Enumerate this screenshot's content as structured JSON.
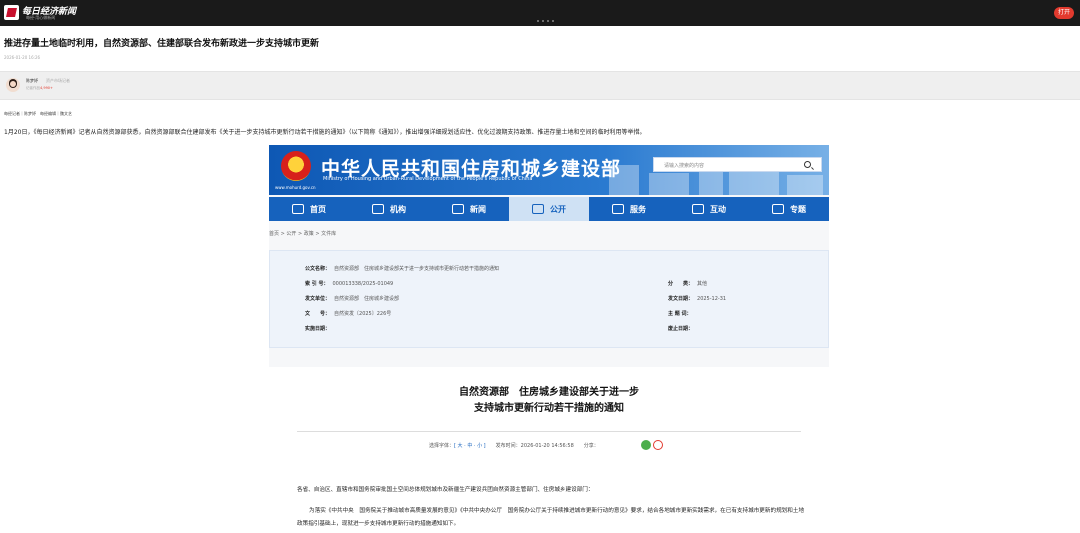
{
  "app": {
    "brand": "每日经济新闻",
    "brand_sub": "每经·用心做新闻",
    "open_label": "打开"
  },
  "article": {
    "title": "推进存量土地临时利用，自然资源部、住建部联合发布新政进一步支持城市更新",
    "datetime": "2026-01-20 16:26",
    "author_name": "陈梦妤",
    "author_role": "资产市场记者",
    "author_stat_prefix": "记者作品",
    "author_stat_count": "4,990+",
    "credits": "每经记者｜陈梦妤　每经编辑｜魏文艺",
    "lead": "1月20日，《每日经济新闻》记者从自然资源部获悉，自然资源部联合住建部发布《关于进一步支持城市更新行动若干措施的通知》（以下简称《通知》），推出增强详细规划适应性、优化过渡期支持政策、推进存量土地和空间的临时利用等举措。"
  },
  "embedded": {
    "site_cn": "中华人民共和国住房和城乡建设部",
    "site_en": "Ministry of Housing and Urban-Rural Development of the People's Republic of China",
    "site_url": "www.mohurd.gov.cn",
    "search_placeholder": "请输入搜索的内容",
    "nav": [
      "首页",
      "机构",
      "新闻",
      "公开",
      "服务",
      "互动",
      "专题"
    ],
    "breadcrumb": "首页 > 公开 > 政策 > 文件库",
    "meta": {
      "doc_name_label": "公文名称：",
      "doc_name": "自然资源部　住房城乡建设部关于进一步支持城市更新行动若干措施的通知",
      "index_label": "索 引 号：",
      "index": "000013338/2025-01049",
      "category_label": "分　　类：",
      "category": "其他",
      "issuer_label": "发文单位：",
      "issuer": "自然资源部　住房城乡建设部",
      "issue_date_label": "发文日期：",
      "issue_date": "2025-12-31",
      "number_label": "文　　号：",
      "number": "自然资发〔2025〕226号",
      "topic_label": "主 题 词：",
      "topic": "",
      "effective_label": "实施日期：",
      "effective": "",
      "expire_label": "废止日期：",
      "expire": ""
    },
    "doc_title_1": "自然资源部　住房城乡建设部关于进一步",
    "doc_title_2": "支持城市更新行动若干措施的通知",
    "font_label": "选择字体：",
    "font_sizes": "[ 大 · 中 · 小 ]",
    "publish_label": "发布时间：",
    "publish_time": "2026-01-20 14:56:58",
    "share_label": "分享：",
    "para1": "各省、自治区、直辖市和国务院审批国土空间总体规划城市及新疆生产建设兵团自然资源主管部门、住房城乡建设部门：",
    "para2": "为落实《中共中央　国务院关于推动城市高质量发展的意见》《中共中央办公厅　国务院办公厅关于持续推进城市更新行动的意见》要求，结合各地城市更新实践需求，在已有支持城市更新的规划和土地政策指引基础上，现就进一步支持城市更新行动的措施通知如下。"
  },
  "colors": {
    "topbar": "#1a1a1a",
    "accent_red": "#e23a2e",
    "gov_blue": "#1662bd"
  }
}
